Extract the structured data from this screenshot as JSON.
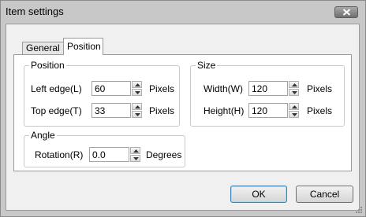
{
  "window": {
    "title": "Item settings"
  },
  "tabs": [
    {
      "label": "General"
    },
    {
      "label": "Position"
    }
  ],
  "position_group": {
    "legend": "Position",
    "left_edge": {
      "label": "Left edge(L)",
      "value": "60",
      "unit": "Pixels"
    },
    "top_edge": {
      "label": "Top edge(T)",
      "value": "33",
      "unit": "Pixels"
    }
  },
  "size_group": {
    "legend": "Size",
    "width": {
      "label": "Width(W)",
      "value": "120",
      "unit": "Pixels"
    },
    "height": {
      "label": "Height(H)",
      "value": "120",
      "unit": "Pixels"
    }
  },
  "angle_group": {
    "legend": "Angle",
    "rotation": {
      "label": "Rotation(R)",
      "value": "0.0",
      "unit": "Degrees"
    }
  },
  "buttons": {
    "ok": "OK",
    "cancel": "Cancel"
  },
  "icons": {
    "close": "close-icon",
    "spin_up": "arrow-up-icon",
    "spin_down": "arrow-down-icon"
  }
}
